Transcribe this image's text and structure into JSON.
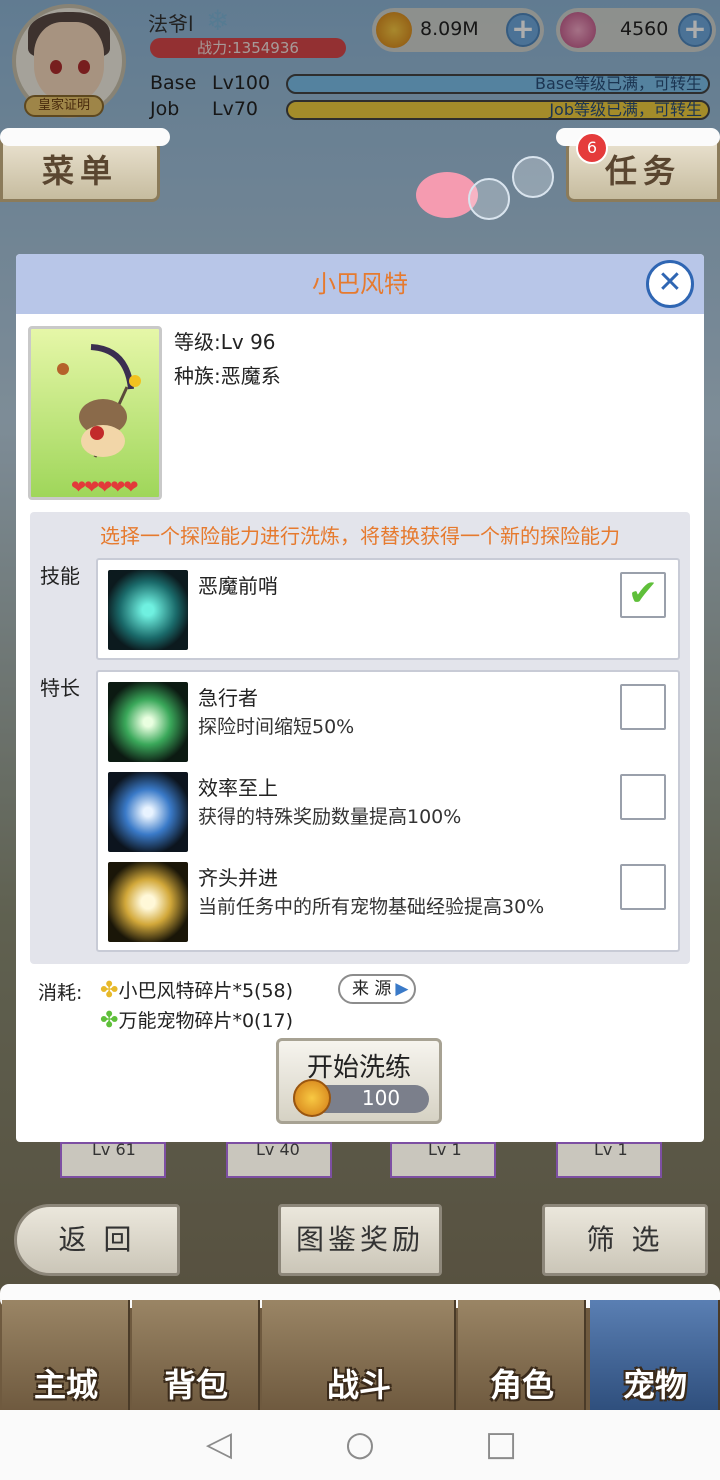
{
  "player": {
    "name": "法爷l",
    "guild": "皇家证明",
    "power": "战力:1354936",
    "base_label": "Base",
    "base_level": "Lv100",
    "base_status": "Base等级已满，可转生",
    "job_label": "Job",
    "job_level": "Lv70",
    "job_status": "Job等级已满，可转生"
  },
  "currency": {
    "zeny": "8.09M",
    "gems": "4560",
    "plus": "+"
  },
  "top_buttons": {
    "menu": "菜单",
    "quest": "任务",
    "quest_badge": "6"
  },
  "modal": {
    "title": "小巴风特",
    "close": "✕",
    "level_label": "等级:",
    "level_value": "Lv 96",
    "race_label": "种族:",
    "race_value": "恶魔系",
    "hearts": "❤❤❤❤❤",
    "hint": "选择一个探险能力进行洗炼，将替换获得一个新的探险能力",
    "skill_section": "技能",
    "talent_section": "特长",
    "skill": {
      "name": "恶魔前哨",
      "checked": true
    },
    "talents": [
      {
        "name": "急行者",
        "desc": "探险时间缩短50%",
        "checked": false
      },
      {
        "name": "效率至上",
        "desc": "获得的特殊奖励数量提高100%",
        "checked": false
      },
      {
        "name": "齐头并进",
        "desc": "当前任务中的所有宠物基础经验提高30%",
        "checked": false
      }
    ],
    "cost_label": "消耗:",
    "cost_items": [
      "小巴风特碎片*5(58)",
      "万能宠物碎片*0(17)"
    ],
    "source_btn": "来 源",
    "start_btn": "开始洗练",
    "start_cost": "100"
  },
  "pet_strip_levels": [
    "Lv 61",
    "Lv 40",
    "Lv 1",
    "Lv 1"
  ],
  "bottom_buttons": {
    "back": "返 回",
    "album_reward": "图鉴奖励",
    "filter": "筛 选"
  },
  "tabs": [
    "主城",
    "背包",
    "战斗",
    "角色",
    "宠物"
  ],
  "colors": {
    "accent_orange": "#e67a2e",
    "header_blue": "#b8c6e8",
    "check_green": "#5fbf3a"
  }
}
